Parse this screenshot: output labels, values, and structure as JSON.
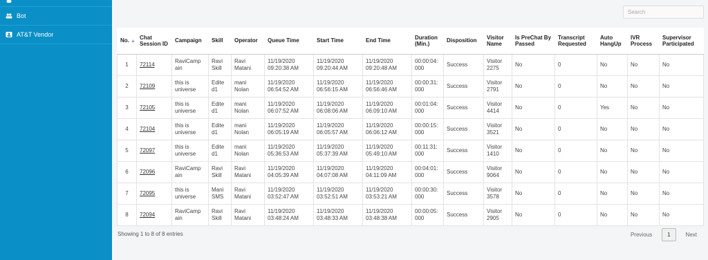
{
  "sidebar": {
    "items": [
      {
        "label": ""
      },
      {
        "label": "Bot"
      },
      {
        "label": "AT&T Vendor"
      }
    ]
  },
  "search": {
    "placeholder": "Search"
  },
  "table": {
    "headers": [
      "No.",
      "Chat Session ID",
      "Campaign",
      "Skill",
      "Operator",
      "Queue Time",
      "Start Time",
      "End Time",
      "Duration (Min.)",
      "Disposition",
      "Visitor Name",
      "Is PreChat By Passed",
      "Transcript Requested",
      "Auto HangUp",
      "IVR Process",
      "Supervisor Participated"
    ],
    "rows": [
      [
        "1",
        "72114",
        "RaviCamp ain",
        "Ravi Skill",
        "Ravi Matani",
        "11/19/2020 09:20:38 AM",
        "11/19/2020 09:20:44 AM",
        "11/19/2020 09:20:48 AM",
        "00:00:04: 000",
        "Success",
        "Visitor 2275",
        "No",
        "0",
        "No",
        "No",
        "No"
      ],
      [
        "2",
        "72109",
        "this is universe",
        "Edite d1",
        "mani Nolan",
        "11/19/2020 06:54:52 AM",
        "11/19/2020 06:56:15 AM",
        "11/19/2020 06:56:46 AM",
        "00:00:31: 000",
        "Success",
        "Visitor 2791",
        "No",
        "0",
        "No",
        "No",
        "No"
      ],
      [
        "3",
        "72105",
        "this is universe",
        "Edite d1",
        "mani Nolan",
        "11/19/2020 06:07:52 AM",
        "11/19/2020 06:08:06 AM",
        "11/19/2020 06:09:10 AM",
        "00:01:04: 000",
        "Success",
        "Visitor 4414",
        "No",
        "0",
        "Yes",
        "No",
        "No"
      ],
      [
        "4",
        "72104",
        "this is universe",
        "Edite d1",
        "mani Nolan",
        "11/19/2020 06:05:19 AM",
        "11/19/2020 06:05:57 AM",
        "11/19/2020 06:06:12 AM",
        "00:00:15: 000",
        "Success",
        "Visitor 3521",
        "No",
        "0",
        "No",
        "No",
        "No"
      ],
      [
        "5",
        "72097",
        "this is universe",
        "Edite d1",
        "mani Nolan",
        "11/19/2020 05:36:53 AM",
        "11/19/2020 05:37:39 AM",
        "11/19/2020 05:49:10 AM",
        "00:11:31: 000",
        "Success",
        "Visitor 1410",
        "No",
        "0",
        "No",
        "No",
        "No"
      ],
      [
        "6",
        "72096",
        "RaviCamp ain",
        "Ravi Skill",
        "Ravi Matani",
        "11/19/2020 04:05:39 AM",
        "11/19/2020 04:07:08 AM",
        "11/19/2020 04:11:09 AM",
        "00:04:01: 000",
        "Success",
        "Visitor 9064",
        "No",
        "0",
        "No",
        "No",
        "No"
      ],
      [
        "7",
        "72095",
        "this is universe",
        "Mani SMS",
        "Ravi Matani",
        "11/19/2020 03:52:47 AM",
        "11/19/2020 03:52:51 AM",
        "11/19/2020 03:53:21 AM",
        "00:00:30: 000",
        "Success",
        "Visitor 3578",
        "No",
        "0",
        "No",
        "No",
        "No"
      ],
      [
        "8",
        "72094",
        "RaviCamp ain",
        "Ravi Skill",
        "Ravi Matani",
        "11/19/2020 03:48:24 AM",
        "11/19/2020 03:48:33 AM",
        "11/19/2020 03:48:38 AM",
        "00:00:05: 000",
        "Success",
        "Visitor 2905",
        "No",
        "0",
        "No",
        "No",
        "No"
      ]
    ]
  },
  "footer": {
    "info": "Showing 1 to 8 of 8 entries"
  },
  "pager": {
    "previous": "Previous",
    "page": "1",
    "next": "Next"
  },
  "colors": {
    "sidebar": "#0a8fc7",
    "sort_arrow": "#8aa3d6"
  }
}
